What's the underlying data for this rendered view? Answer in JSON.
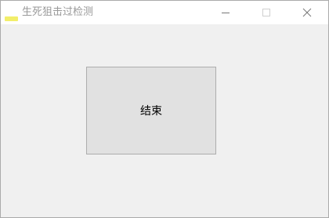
{
  "window": {
    "title": "生死狙击过检测",
    "icon": "app-icon",
    "controls": {
      "minimize": "minimize-icon",
      "maximize": "maximize-icon",
      "close": "close-icon"
    }
  },
  "main": {
    "end_button_label": "结束"
  },
  "colors": {
    "titlebar_bg": "#ffffff",
    "client_bg": "#f0f0f0",
    "button_bg": "#e1e1e1",
    "button_border": "#adadad",
    "title_text": "#999999",
    "app_icon": "#f2ee6a"
  }
}
